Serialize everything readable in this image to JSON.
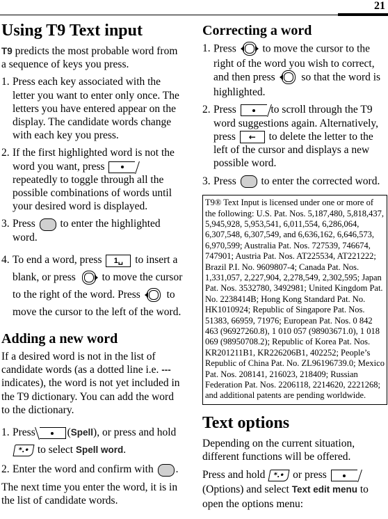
{
  "page": {
    "number": "21"
  },
  "left": {
    "title": "Using T9 Text input",
    "intro_t9": "T9",
    "intro_rest": " predicts the most probable word from a sequence of keys you press.",
    "steps": [
      {
        "num": "1.",
        "text": "Press each key associated with the letter you want to enter only once. The letters you have entered appear on the display. The candidate words change with each key you press."
      },
      {
        "num": "2.",
        "text_a": "If the first highlighted word is not the word you want, press ",
        "text_b": " repeatedly to toggle through all the possible combinations of words until your desired word is displayed."
      },
      {
        "num": "3.",
        "text_a": "Press ",
        "text_b": " to enter the highlighted word."
      },
      {
        "num": "4.",
        "text_a": "To end a word, press ",
        "key_one": "1␣",
        "text_b": " to insert a blank, or press ",
        "text_c": " to move the cursor to the right of the word. Press ",
        "text_d": " to move the cursor to the left of the word."
      }
    ],
    "adding": {
      "title": "Adding a new word",
      "para_a": "If a desired word is not in the list of candidate words (as a dotted line i.e. ",
      "dots": "---",
      "para_b": " indicates), the word is not yet included in the T9 dictionary. You can add the word to the dictionary.",
      "steps": [
        {
          "num": "1.",
          "text_a": "Press ",
          "paren_open": "(",
          "spell": "Spell",
          "text_b": "), or press and hold ",
          "key_star": "*.•",
          "text_c": " to select ",
          "spell_word": "Spell word",
          "text_d": "."
        },
        {
          "num": "2.",
          "text_a": "Enter the word and confirm with ",
          "text_b": "."
        }
      ],
      "outro": "The next time you enter the word, it is in the list of candidate words."
    }
  },
  "right": {
    "correcting": {
      "title": "Correcting a word",
      "steps": [
        {
          "num": "1.",
          "text_a": "Press ",
          "text_b": " to move the cursor to the right of the word you wish to correct, and then press ",
          "text_c": " so that the word is highlighted."
        },
        {
          "num": "2.",
          "text_a": "Press ",
          "text_b": " to scroll through the T9 word suggestions again. Alternatively, press ",
          "key_back": "←",
          "text_c": " to delete the letter to the left of the cursor and displays a new possible word."
        },
        {
          "num": "3.",
          "text_a": "Press ",
          "text_b": " to enter the corrected word."
        }
      ]
    },
    "patent_notice": "T9® Text Input is licensed under one or more of the following: U.S. Pat. Nos. 5,187,480, 5,818,437, 5,945,928, 5,953,541, 6,011,554, 6,286,064, 6,307,548, 6,307,549, and 6,636,162, 6,646,573, 6,970,599; Australia Pat. Nos. 727539, 746674, 747901; Austria Pat. Nos. AT225534, AT221222; Brazil P.I. No. 9609807-4; Canada Pat. Nos. 1,331,057, 2,227,904, 2,278,549, 2,302,595; Japan Pat. Nos. 3532780, 3492981; United Kingdom Pat. No. 2238414B; Hong Kong Standard Pat. No. HK1010924; Republic of Singapore Pat. Nos. 51383, 66959, 71976; European Pat. Nos. 0 842 463 (96927260.8), 1 010 057 (98903671.0), 1 018 069 (98950708.2); Republic of Korea Pat. Nos. KR201211B1, KR226206B1, 402252; People’s Republic of China Pat. No. ZL96196739.0; Mexico Pat. Nos. 208141, 216023, 218409; Russian Federation Pat. Nos. 2206118, 2214620, 2221268; and additional patents are pending worldwide.",
    "text_options": {
      "title": "Text options",
      "para1": "Depending on the current situation, different functions will be offered.",
      "para2_a": "Press and hold ",
      "key_star": "*.•",
      "para2_b": " or press ",
      "para2_c": "(Options) and select ",
      "menu_name": "Text edit menu",
      "para2_d": " to open the options menu:"
    }
  }
}
